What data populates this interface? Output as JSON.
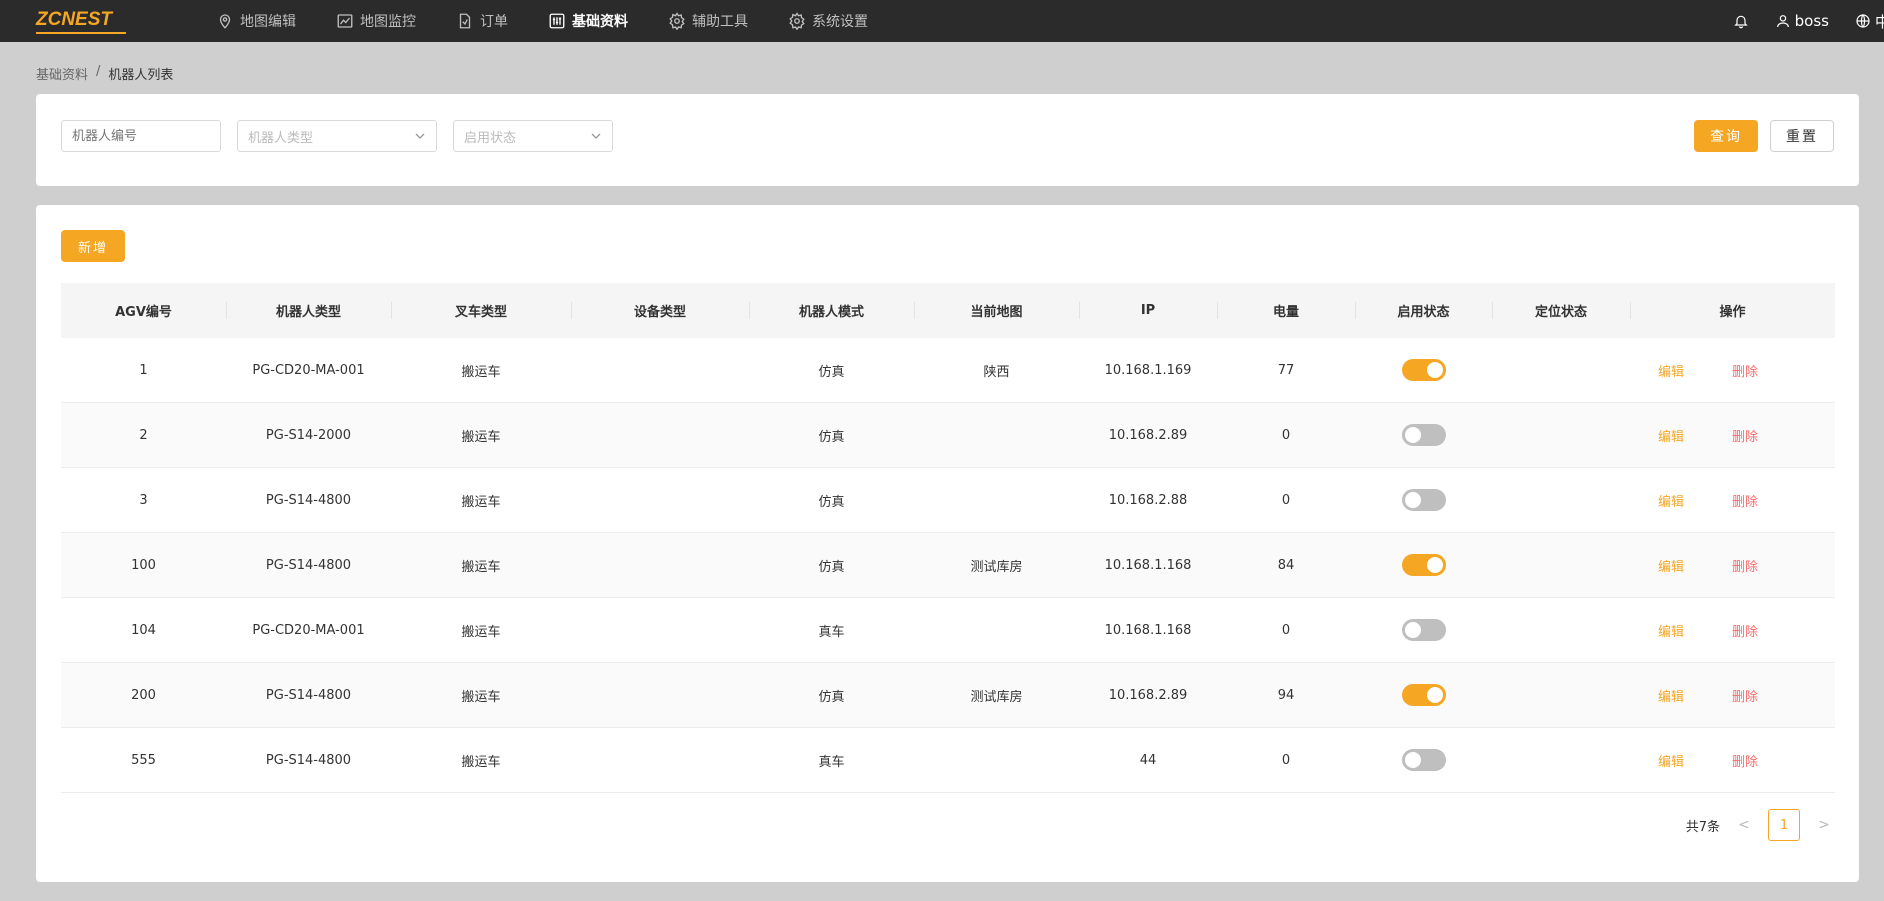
{
  "brand": {
    "logo_text": "ZCNEST",
    "accent": "#f5a623"
  },
  "nav": {
    "items": [
      {
        "label": "地图编辑",
        "icon": "map-pin-icon",
        "active": false
      },
      {
        "label": "地图监控",
        "icon": "chart-icon",
        "active": false
      },
      {
        "label": "订单",
        "icon": "document-icon",
        "active": false
      },
      {
        "label": "基础资料",
        "icon": "sliders-icon",
        "active": true
      },
      {
        "label": "辅助工具",
        "icon": "gear-icon",
        "active": false
      },
      {
        "label": "系统设置",
        "icon": "gear-icon",
        "active": false
      }
    ],
    "user": "boss",
    "lang": "中"
  },
  "breadcrumb": {
    "parent": "基础资料",
    "separator": "/",
    "current": "机器人列表"
  },
  "filters": {
    "robot_no_placeholder": "机器人编号",
    "robot_type_placeholder": "机器人类型",
    "status_placeholder": "启用状态",
    "query_label": "查询",
    "reset_label": "重置"
  },
  "toolbar": {
    "add_label": "新增"
  },
  "table": {
    "headers": [
      "AGV编号",
      "机器人类型",
      "叉车类型",
      "设备类型",
      "机器人模式",
      "当前地图",
      "IP",
      "电量",
      "启用状态",
      "定位状态",
      "操作"
    ],
    "edit_label": "编辑",
    "delete_label": "删除",
    "rows": [
      {
        "agv": "1",
        "robot_type": "PG-CD20-MA-001",
        "fork_type": "搬运车",
        "device_type": "",
        "mode": "仿真",
        "map": "陕西",
        "ip": "10.168.1.169",
        "battery": "77",
        "enabled": true,
        "locate": ""
      },
      {
        "agv": "2",
        "robot_type": "PG-S14-2000",
        "fork_type": "搬运车",
        "device_type": "",
        "mode": "仿真",
        "map": "",
        "ip": "10.168.2.89",
        "battery": "0",
        "enabled": false,
        "locate": ""
      },
      {
        "agv": "3",
        "robot_type": "PG-S14-4800",
        "fork_type": "搬运车",
        "device_type": "",
        "mode": "仿真",
        "map": "",
        "ip": "10.168.2.88",
        "battery": "0",
        "enabled": false,
        "locate": ""
      },
      {
        "agv": "100",
        "robot_type": "PG-S14-4800",
        "fork_type": "搬运车",
        "device_type": "",
        "mode": "仿真",
        "map": "测试库房",
        "ip": "10.168.1.168",
        "battery": "84",
        "enabled": true,
        "locate": ""
      },
      {
        "agv": "104",
        "robot_type": "PG-CD20-MA-001",
        "fork_type": "搬运车",
        "device_type": "",
        "mode": "真车",
        "map": "",
        "ip": "10.168.1.168",
        "battery": "0",
        "enabled": false,
        "locate": ""
      },
      {
        "agv": "200",
        "robot_type": "PG-S14-4800",
        "fork_type": "搬运车",
        "device_type": "",
        "mode": "仿真",
        "map": "测试库房",
        "ip": "10.168.2.89",
        "battery": "94",
        "enabled": true,
        "locate": ""
      },
      {
        "agv": "555",
        "robot_type": "PG-S14-4800",
        "fork_type": "搬运车",
        "device_type": "",
        "mode": "真车",
        "map": "",
        "ip": "44",
        "battery": "0",
        "enabled": false,
        "locate": ""
      }
    ]
  },
  "pagination": {
    "total_text": "共7条",
    "current_page": "1",
    "prev": "<",
    "next": ">"
  }
}
